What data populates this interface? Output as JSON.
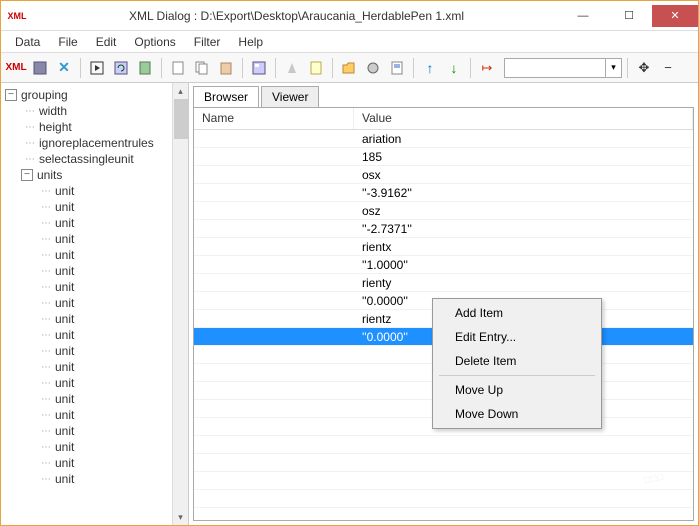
{
  "window": {
    "title": "XML Dialog : D:\\Export\\Desktop\\Araucania_HerdablePen 1.xml",
    "app_icon_label": "XML"
  },
  "winbuttons": {
    "min": "—",
    "max": "☐",
    "close": "✕"
  },
  "menu": [
    "Data",
    "File",
    "Edit",
    "Options",
    "Filter",
    "Help"
  ],
  "toolbar": {
    "xml_label": "XML",
    "combo_value": ""
  },
  "tree": {
    "root": {
      "label": "grouping",
      "toggle": "−"
    },
    "children": [
      "width",
      "height",
      "ignoreplacementrules",
      "selectassingleunit"
    ],
    "units": {
      "label": "units",
      "toggle": "−"
    },
    "unit_items": [
      "unit",
      "unit",
      "unit",
      "unit",
      "unit",
      "unit",
      "unit",
      "unit",
      "unit",
      "unit",
      "unit",
      "unit",
      "unit",
      "unit",
      "unit",
      "unit",
      "unit",
      "unit",
      "unit"
    ]
  },
  "tabs": {
    "browser": "Browser",
    "viewer": "Viewer"
  },
  "grid": {
    "headers": {
      "name": "Name",
      "value": "Value"
    },
    "rows": [
      {
        "name": "",
        "value": "ariation"
      },
      {
        "name": "",
        "value": "185"
      },
      {
        "name": "",
        "value": "osx"
      },
      {
        "name": "",
        "value": "''-3.9162''"
      },
      {
        "name": "",
        "value": "osz"
      },
      {
        "name": "",
        "value": "''-2.7371''"
      },
      {
        "name": "",
        "value": "rientx"
      },
      {
        "name": "",
        "value": "''1.0000''"
      },
      {
        "name": "",
        "value": "rienty"
      },
      {
        "name": "",
        "value": "''0.0000''"
      },
      {
        "name": "",
        "value": "rientz"
      },
      {
        "name": "",
        "value": "''0.0000''",
        "selected": true
      }
    ]
  },
  "contextmenu": {
    "add": "Add Item",
    "edit": "Edit Entry...",
    "delete": "Delete Item",
    "moveup": "Move Up",
    "movedown": "Move Down"
  }
}
